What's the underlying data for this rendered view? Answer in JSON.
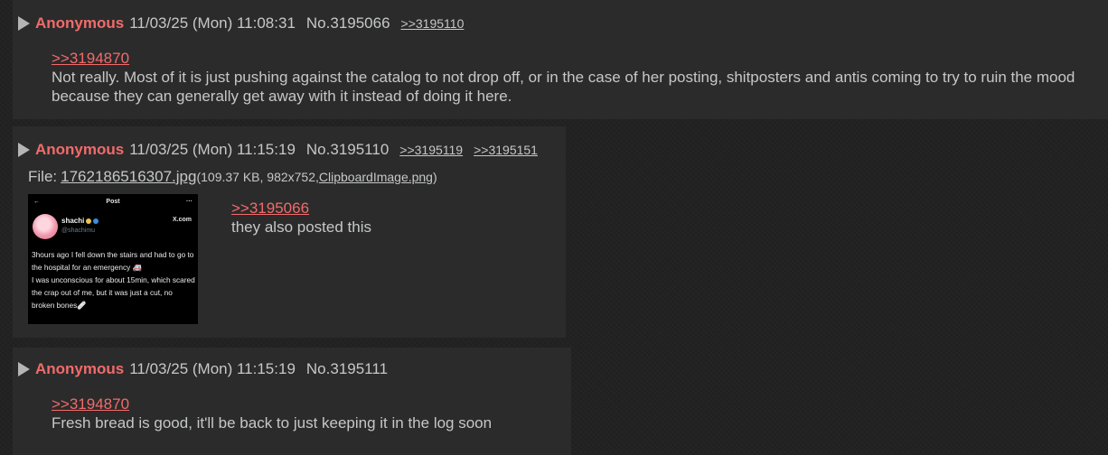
{
  "posts": [
    {
      "name": "Anonymous",
      "datetime": "11/03/25 (Mon) 11:08:31",
      "number": "No.3195066",
      "backlinks": [
        ">>3195110"
      ],
      "quote": ">>3194870",
      "text": "Not really. Most of it is just pushing against the catalog to not drop off, or in the case of her posting, shitposters and antis coming to try to ruin the mood because they can generally get away with it instead of doing it here."
    },
    {
      "name": "Anonymous",
      "datetime": "11/03/25 (Mon) 11:15:19",
      "number": "No.3195110",
      "backlinks": [
        ">>3195119",
        ">>3195151"
      ],
      "file": {
        "label": "File:",
        "filename": "1762186516307.jpg",
        "meta_open": "(109.37 KB, 982x752, ",
        "original_name": "ClipboardImage.png",
        "meta_close": ")"
      },
      "thumbnail": {
        "topbar_back": "←",
        "topbar_title": "Post",
        "topbar_more": "···",
        "user_name": "shachi",
        "handle": "@shachimu",
        "source": "X.com",
        "tweet_text": "3hours ago I fell down the stairs and had to go to the hospital for an emergency 🚑\nI was unconscious for about 15min, which scared the crap out of me, but it was just a cut, no broken bones🩹"
      },
      "quote": ">>3195066",
      "text": "they also posted this"
    },
    {
      "name": "Anonymous",
      "datetime": "11/03/25 (Mon) 11:15:19",
      "number": "No.3195111",
      "backlinks": [],
      "quote": ">>3194870",
      "text": "Fresh bread is good, it'll be back to just keeping it in the log soon"
    }
  ],
  "colors": {
    "name": "#f26b6b",
    "quotelink": "#f26b6b",
    "text": "#c5c8c6",
    "post_bg": "#2b2b2b",
    "page_bg": "#222222"
  }
}
